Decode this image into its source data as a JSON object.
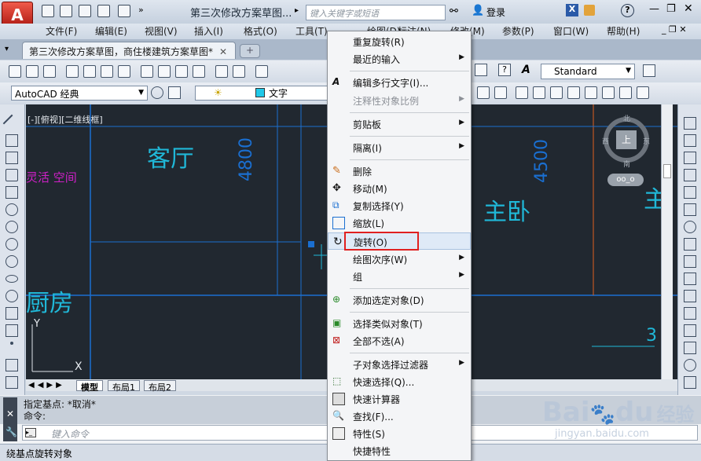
{
  "app": {
    "logo": "A",
    "title": "第三次修改方案草图...",
    "search_placeholder": "键入关键字或短语",
    "login": "登录"
  },
  "menubar": [
    "文件(F)",
    "编辑(E)",
    "视图(V)",
    "插入(I)",
    "格式(O)",
    "工具(T)",
    "绘图(D)",
    "标注(N)",
    "修改(M)",
    "参数(P)",
    "窗口(W)",
    "帮助(H)"
  ],
  "doc_tab": "第三次修改方案草图，商住楼建筑方案草图*",
  "toolbar": {
    "workspace": "AutoCAD 经典",
    "text_style": "Standard",
    "layer_text": "文字"
  },
  "viewport": {
    "label": "[-][俯视][二维线框]",
    "rooms": [
      "客厅",
      "主卧",
      "厨房",
      "主"
    ],
    "dims": [
      "4800",
      "4500",
      "3"
    ],
    "magenta": "灵活 空间",
    "compass": {
      "n": "北",
      "s": "南",
      "e": "东",
      "w": "西",
      "center": "上"
    },
    "wcs": "oo_o",
    "y": "Y",
    "x": "X"
  },
  "layout_tabs": [
    "模型",
    "布局1",
    "布局2"
  ],
  "command": {
    "history": [
      "指定基点: *取消*",
      "命令:"
    ],
    "placeholder": "键入命令"
  },
  "status": "绕基点旋转对象",
  "context_menu": {
    "items": [
      {
        "label": "重复旋转(R)",
        "submenu": false,
        "disabled": false
      },
      {
        "label": "最近的输入",
        "submenu": true,
        "disabled": false
      },
      {
        "label": "编辑多行文字(I)...",
        "submenu": false,
        "disabled": false,
        "icon": "text-edit-icon"
      },
      {
        "label": "注释性对象比例",
        "submenu": true,
        "disabled": true
      },
      {
        "label": "剪贴板",
        "submenu": true,
        "disabled": false
      },
      {
        "label": "隔离(I)",
        "submenu": true,
        "disabled": false
      },
      {
        "label": "删除",
        "submenu": false,
        "disabled": false,
        "icon": "erase-icon"
      },
      {
        "label": "移动(M)",
        "submenu": false,
        "disabled": false,
        "icon": "move-icon"
      },
      {
        "label": "复制选择(Y)",
        "submenu": false,
        "disabled": false,
        "icon": "copy-icon"
      },
      {
        "label": "缩放(L)",
        "submenu": false,
        "disabled": false,
        "icon": "scale-icon"
      },
      {
        "label": "旋转(O)",
        "submenu": false,
        "disabled": false,
        "icon": "rotate-icon"
      },
      {
        "label": "绘图次序(W)",
        "submenu": true,
        "disabled": false
      },
      {
        "label": "组",
        "submenu": true,
        "disabled": false
      },
      {
        "label": "添加选定对象(D)",
        "submenu": false,
        "disabled": false,
        "icon": "add-selected-icon"
      },
      {
        "label": "选择类似对象(T)",
        "submenu": false,
        "disabled": false,
        "icon": "select-similar-icon"
      },
      {
        "label": "全部不选(A)",
        "submenu": false,
        "disabled": false,
        "icon": "deselect-icon"
      },
      {
        "label": "子对象选择过滤器",
        "submenu": true,
        "disabled": false
      },
      {
        "label": "快速选择(Q)...",
        "submenu": false,
        "disabled": false,
        "icon": "quick-select-icon"
      },
      {
        "label": "快速计算器",
        "submenu": false,
        "disabled": false,
        "icon": "calculator-icon"
      },
      {
        "label": "查找(F)...",
        "submenu": false,
        "disabled": false,
        "icon": "find-icon"
      },
      {
        "label": "特性(S)",
        "submenu": false,
        "disabled": false,
        "icon": "properties-icon"
      },
      {
        "label": "快捷特性",
        "submenu": false,
        "disabled": false
      }
    ]
  },
  "watermark": {
    "brand": "Bai",
    "brand2": "du",
    "cn": "经验",
    "url": "jingyan.baidu.com"
  },
  "colors": {
    "drawing_bg": "#212830",
    "cyan": "#20b8d8",
    "blue_line": "#1a6fd1",
    "red": "#e02020",
    "magenta": "#d020c8"
  }
}
